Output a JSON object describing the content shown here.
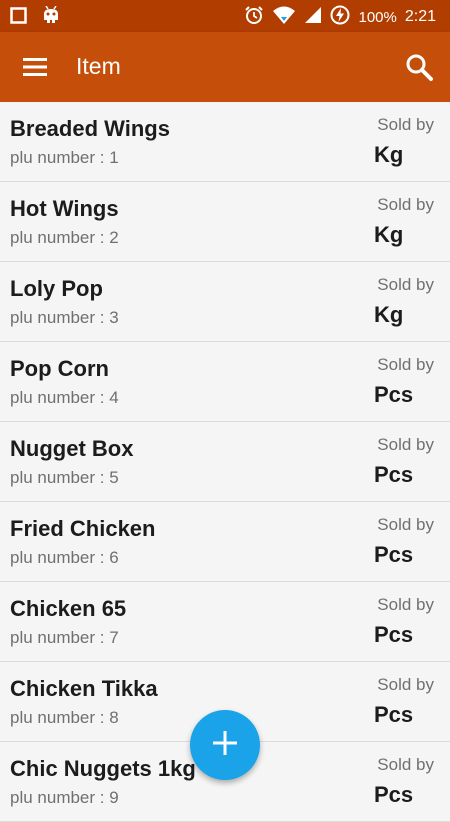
{
  "status_bar": {
    "battery": "100%",
    "time": "2:21"
  },
  "app_bar": {
    "title": "Item"
  },
  "items": [
    {
      "name": "Breaded Wings",
      "plu": "plu number : 1",
      "sold_by_label": "Sold by",
      "unit": "Kg"
    },
    {
      "name": "Hot Wings",
      "plu": "plu number : 2",
      "sold_by_label": "Sold by",
      "unit": "Kg"
    },
    {
      "name": "Loly Pop",
      "plu": "plu number : 3",
      "sold_by_label": "Sold by",
      "unit": "Kg"
    },
    {
      "name": "Pop Corn",
      "plu": "plu number : 4",
      "sold_by_label": "Sold by",
      "unit": "Pcs"
    },
    {
      "name": "Nugget Box",
      "plu": "plu number : 5",
      "sold_by_label": "Sold by",
      "unit": "Pcs"
    },
    {
      "name": "Fried Chicken",
      "plu": "plu number : 6",
      "sold_by_label": "Sold by",
      "unit": "Pcs"
    },
    {
      "name": "Chicken 65",
      "plu": "plu number : 7",
      "sold_by_label": "Sold by",
      "unit": "Pcs"
    },
    {
      "name": "Chicken Tikka",
      "plu": "plu number : 8",
      "sold_by_label": "Sold by",
      "unit": "Pcs"
    },
    {
      "name": "Chic Nuggets 1kg",
      "plu": "plu number : 9",
      "sold_by_label": "Sold by",
      "unit": "Pcs"
    }
  ],
  "icons": {
    "menu": "menu-icon",
    "search": "search-icon",
    "add": "plus-icon"
  },
  "colors": {
    "status_bar": "#b23d00",
    "app_bar": "#c54f0a",
    "fab": "#1aa3e8"
  }
}
